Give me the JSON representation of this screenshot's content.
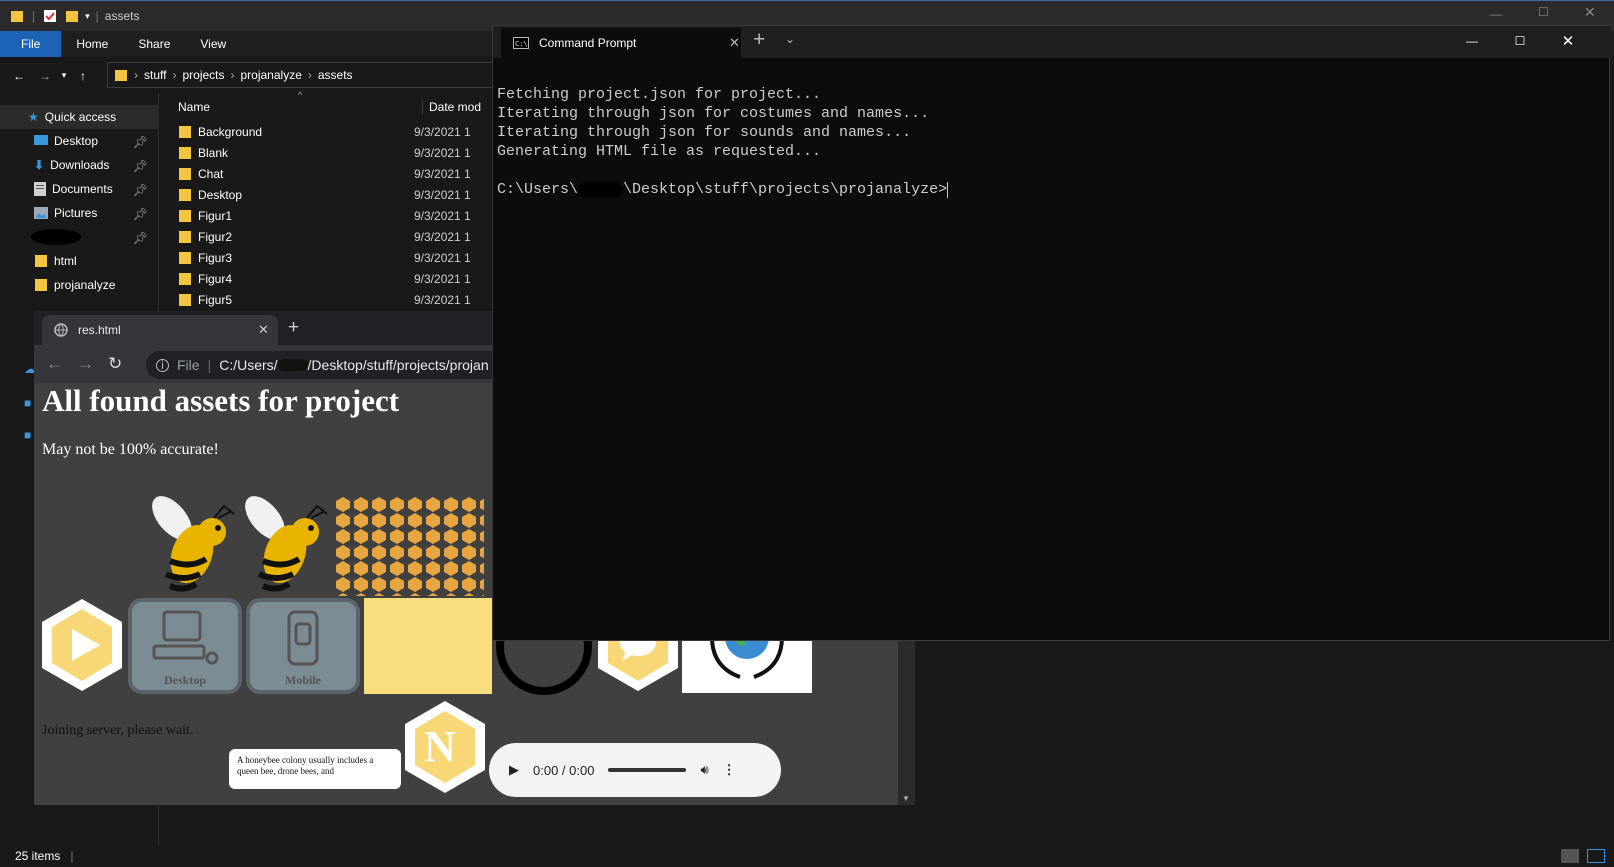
{
  "explorer": {
    "title": "assets",
    "ribbon_tabs": [
      "File",
      "Home",
      "Share",
      "View"
    ],
    "breadcrumb": [
      "stuff",
      "projects",
      "projanalyze",
      "assets"
    ],
    "columns": {
      "name": "Name",
      "date": "Date mod"
    },
    "quick_access": "Quick access",
    "sidebar": [
      {
        "label": "Desktop",
        "icon": "desktop-icon",
        "pinned": true
      },
      {
        "label": "Downloads",
        "icon": "download-icon",
        "pinned": true
      },
      {
        "label": "Documents",
        "icon": "documents-icon",
        "pinned": true
      },
      {
        "label": "Pictures",
        "icon": "pictures-icon",
        "pinned": true
      },
      {
        "label": "",
        "icon": "redacted",
        "pinned": true
      },
      {
        "label": "html",
        "icon": "folder-icon",
        "pinned": false
      },
      {
        "label": "projanalyze",
        "icon": "folder-icon",
        "pinned": false
      }
    ],
    "files": [
      {
        "name": "Background",
        "date": "9/3/2021 1"
      },
      {
        "name": "Blank",
        "date": "9/3/2021 1"
      },
      {
        "name": "Chat",
        "date": "9/3/2021 1"
      },
      {
        "name": "Desktop",
        "date": "9/3/2021 1"
      },
      {
        "name": "Figur1",
        "date": "9/3/2021 1"
      },
      {
        "name": "Figur2",
        "date": "9/3/2021 1"
      },
      {
        "name": "Figur3",
        "date": "9/3/2021 1"
      },
      {
        "name": "Figur4",
        "date": "9/3/2021 1"
      },
      {
        "name": "Figur5",
        "date": "9/3/2021 1"
      }
    ],
    "status": "25 items"
  },
  "chrome": {
    "tab_title": "res.html",
    "url_prefix": "File",
    "url_before": "C:/Users/",
    "url_after": "/Desktop/stuff/projects/projan",
    "heading": "All found assets for project",
    "subtitle": "May not be 100% accurate!",
    "desktop_label": "Desktop",
    "mobile_label": "Mobile",
    "joining": "Joining server, please wait.",
    "bubble_text": "A honeybee colony usually includes a queen bee, drone bees, and",
    "n_letter": "N",
    "audio_time": "0:00 / 0:00"
  },
  "cmd": {
    "tab_title": "Command Prompt",
    "lines": [
      "Fetching project.json for project...",
      "Iterating through json for costumes and names...",
      "Iterating through json for sounds and names...",
      "Generating HTML file as requested..."
    ],
    "prompt_before": "C:\\Users\\",
    "prompt_after": "\\Desktop\\stuff\\projects\\projanalyze>"
  },
  "colors": {
    "accent": "#1c63b7",
    "folder": "#f5c542",
    "honey": "#e8a640",
    "hex_yellow": "#f8d776"
  }
}
